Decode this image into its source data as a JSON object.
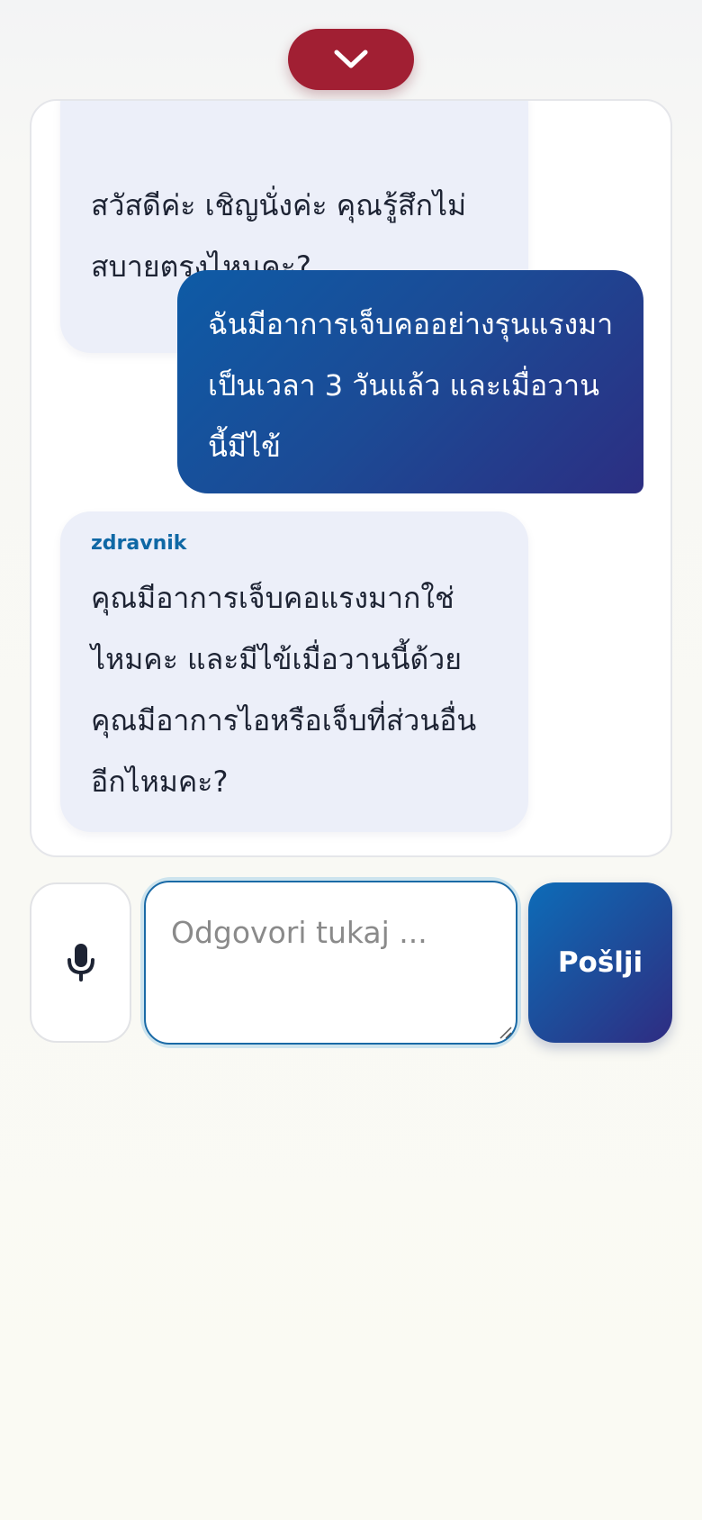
{
  "header": {
    "collapse_icon": "chevron-down-icon",
    "accent_color": "#a11f33"
  },
  "chat": {
    "messages": [
      {
        "role": "assistant",
        "text": "สวัสดีค่ะ เชิญนั่งค่ะ คุณรู้สึกไม่สบายตรงไหนคะ?"
      },
      {
        "role": "user",
        "text": "ฉันมีอาการเจ็บคออย่างรุนแรงมาเป็นเวลา 3 วันแล้ว และเมื่อวานนี้มีไข้"
      },
      {
        "role": "assistant",
        "sender": "zdravnik",
        "text": "คุณมีอาการเจ็บคอแรงมากใช่ไหมคะ และมีไข้เมื่อวานนี้ด้วย คุณมีอาการไอหรือเจ็บที่ส่วนอื่นอีกไหมคะ?"
      }
    ]
  },
  "composer": {
    "mic_icon": "microphone-icon",
    "placeholder": "Odgovori tukaj ...",
    "value": "",
    "send_label": "Pošlji"
  },
  "colors": {
    "user_bubble": "#1c4a95",
    "assistant_bubble": "#eceff9",
    "sender_name": "#0f68a5"
  }
}
